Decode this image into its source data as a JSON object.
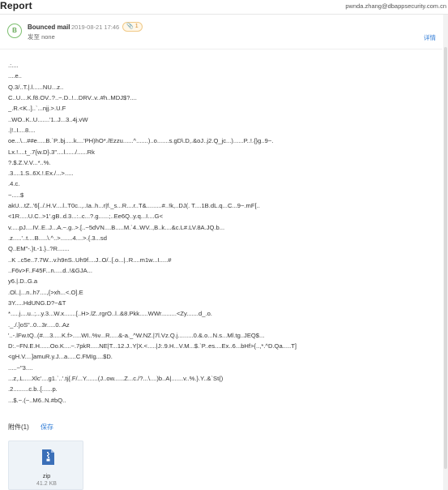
{
  "header": {
    "title": "Report",
    "account_email": "pwnda.zhang@dbappsecurity.com.cn"
  },
  "mail": {
    "avatar_letter": "B",
    "sender": "Bounced mail",
    "date": "2019-08-21 17:46",
    "attachment_count_badge": "1",
    "to_line": "发至 none",
    "details_label": "详情",
    "body_lines": [
      ".:....",
      "....e..",
      "Q.3/..T.|.l......NU...z..",
      "C..U....K.f8.OV..?..~.D..!...DRV..v..#h..MDJ$?....",
      "_.R.<K..]..`...njj.>.U.F",
      "..WO..K..U.......'1..J...3..4j.vW",
      ".|!..I....8....",
      "oe...\\...##e.....B.`P..bj.....k....'PH)hO*./Ezzu......^.......)..o.......s.gD\\.D,.&oJ..j2.Q_jc...)......P..!.{}g..9~.",
      "Lx.!....t_.7{w.D}.3\"....l....../......Rk",
      "?.$.Z.V.V...*..%.",
      ".3....1.S..6X.!.Ex./...>.....",
      ".4.c.",
      "~.....$",
      "akU...tZ..'6[../.H.V....l..T0c..,..Ia..h...r|f._s...R....r..T&.........#..!k,..DJ(. T....1B.dL.q...C...9~.mF[..",
      "<1R.....U.C..>1'.gB..d.3...:..c...?.g......;..Ee6Q..y.q...I....G<",
      "v.....pJ....IV..E..J...A.~.g..>.[..~5dVN....B.....M.`4..WV..,B..k....&c.L#.LV.8A.JQ.b...",
      ".z.....'..t....B.....\\.^..>.......4....>.{.3...sd",
      "Q..EM\"-.}t.-1.}..?R.......",
      "..K ..c5e..7.7W...v.h9nS..Uh9f....J..O/..[.o...|..R....m1w...I.....#",
      "..F6v>F..F45F...n.....d..!&GJA...",
      "y6.|.D..G.a",
      ".Ol..|...n..h7....,{>xh...<.O].E",
      "3Y.....HdUNG.D?~&T",
      "*.....j....u..;...y.3...W.x.......[..H>.lZ..rgrO..l..&8.Pkk.....WWr.........<Zy.......d_.o.",
      "._./.]oS\"..0...3r.....0..Az",
      "'..-.lFw.tQ..(#....3.....K.f>.....WI..%v...R.....&-a._^W.NZ.|7l.Vz.Q.j.........0.&.o...N.s...Ml.tg..JEQ$...",
      "D:.~FN.E.H......Oo.K....~.7pkR.....NE|T...12.J..Y|X.<.....|J:.9.H...V.M...$.`P..es....Ex..6...bHf>{..,*.^D.Qa.....T]",
      "<gH.V....]amuR.y.J...a.....C.FMIg....$D.",
      ".....~\"3....",
      "...z,.L.....Xlc'....g1.`..'.tj{.F/...Y.......(J..ow......Z...c./?...\\....)b..A|.......v..%.}.Y..&`St{)",
      ".2.........c.b..[......p.",
      "...$.~.(~..M6..N.#bQ.."
    ],
    "attachments_header": "附件(1)",
    "save_label": "保存",
    "attachment": {
      "name": "zip",
      "size": "41.2 KB",
      "icon": "zip-file-icon"
    }
  },
  "colors": {
    "link": "#2f7bd6",
    "avatar_ring": "#7dbf6f",
    "badge_bg": "#fff7e8",
    "file_icon": "#3b6fb8"
  }
}
